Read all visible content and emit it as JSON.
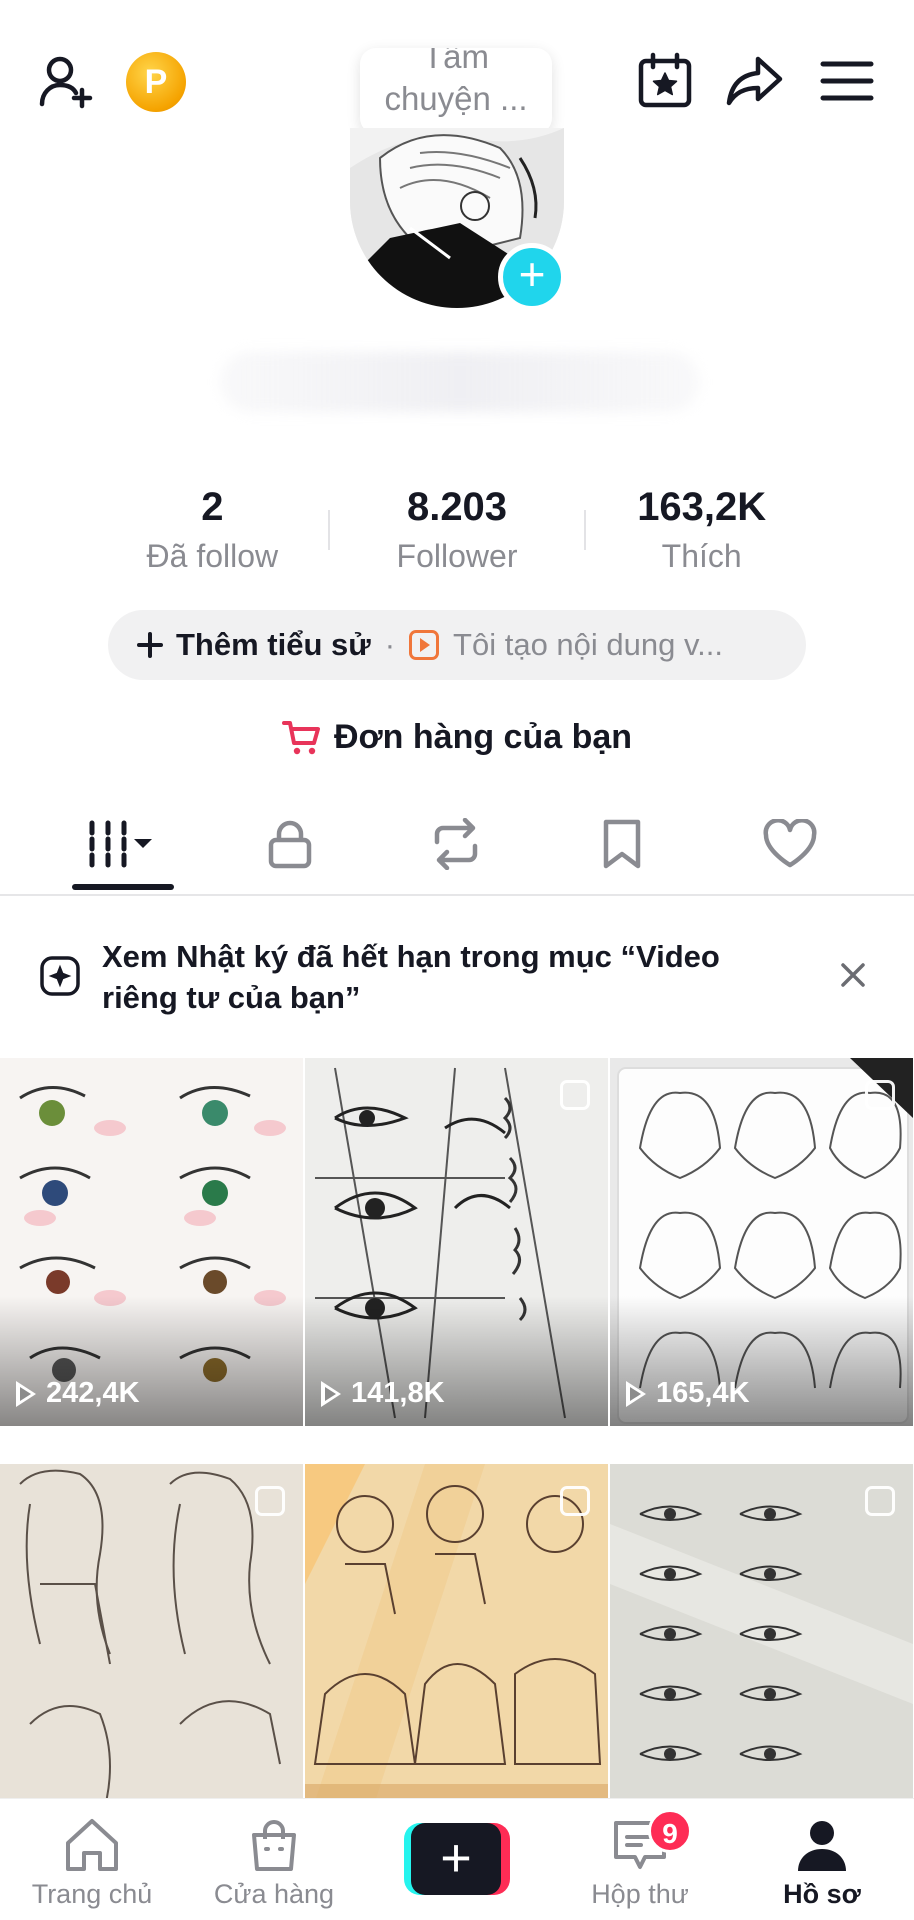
{
  "profile": {
    "note_line1": "Tâm",
    "note_line2": "chuyện ...",
    "stats": [
      {
        "num": "2",
        "label": "Đã follow"
      },
      {
        "num": "8.203",
        "label": "Follower"
      },
      {
        "num": "163,2K",
        "label": "Thích"
      }
    ],
    "bio_add": "Thêm tiểu sử",
    "bio_sep": "·",
    "creator_text": "Tôi tạo nội dung v...",
    "orders": "Đơn hàng của bạn"
  },
  "banner": {
    "text": "Xem Nhật ký đã hết hạn trong mục “Video riêng tư của bạn”"
  },
  "videos": [
    {
      "views": "242,4K",
      "theme": "eyes-color"
    },
    {
      "views": "141,8K",
      "theme": "eyes-sketch"
    },
    {
      "views": "165,4K",
      "theme": "hair-sketch"
    },
    {
      "views": "",
      "theme": "girls-sketch"
    },
    {
      "views": "",
      "theme": "dresses-sketch"
    },
    {
      "views": "",
      "theme": "eyes-notes"
    }
  ],
  "nav": {
    "home": "Trang chủ",
    "shop": "Cửa hàng",
    "inbox": "Hộp thư",
    "inbox_badge": "9",
    "profile": "Hồ sơ"
  },
  "colors": {
    "accent_red": "#fe2c55",
    "accent_cyan": "#25f4ee",
    "avatar_plus": "#20d5ec",
    "cart": "#e8345a"
  }
}
